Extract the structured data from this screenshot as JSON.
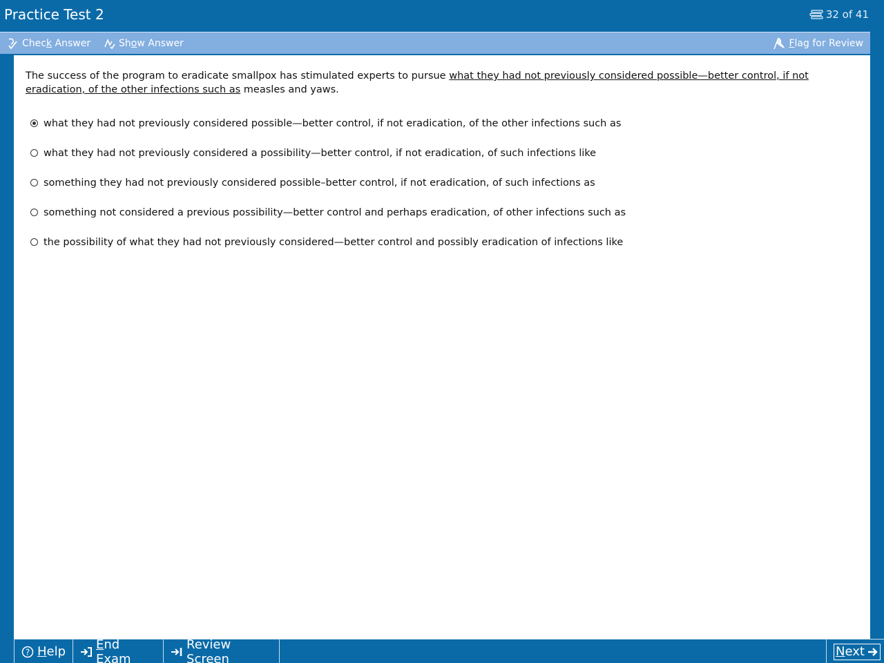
{
  "window": {
    "title": "Practice Test 2",
    "counter": "32 of 41"
  },
  "toolbar": {
    "check_answer": {
      "pre": "Chec",
      "accel": "k",
      "post": " Answer"
    },
    "show_answer": {
      "pre": "Sh",
      "accel": "o",
      "post": "w Answer"
    },
    "flag_review": {
      "pre": "",
      "accel": "F",
      "post": "lag for Review"
    }
  },
  "question": {
    "before": "The success of the program to eradicate smallpox has stimulated experts to pursue ",
    "underlined": "what they had not previously considered possible—better control, if not eradication, of the other infections such as",
    "after": " measles and yaws."
  },
  "choices": [
    {
      "text": "what they had not previously considered possible—better control, if not eradication, of the other infections such as",
      "selected": true
    },
    {
      "text": "what they had not previously considered a possibility—better control, if not eradication, of such infections like",
      "selected": false
    },
    {
      "text": "something they had not previously considered possible–better control, if not eradication, of such infections as",
      "selected": false
    },
    {
      "text": "something not considered a previous possibility—better control and perhaps eradication, of other infections such as",
      "selected": false
    },
    {
      "text": "the possibility of what they had not previously considered—better control and possibly eradication of infections like",
      "selected": false
    }
  ],
  "bottom": {
    "help": {
      "pre": "",
      "accel": "H",
      "post": "elp"
    },
    "end_exam": {
      "pre": "",
      "accel": "E",
      "post": "nd Exam"
    },
    "review_screen": {
      "pre": "Review ",
      "accel": "S",
      "post": "creen"
    },
    "next": {
      "pre": "",
      "accel": "N",
      "post": "ext"
    }
  },
  "colors": {
    "frame": "#0a6aa8",
    "toolbar": "#82aee0"
  }
}
